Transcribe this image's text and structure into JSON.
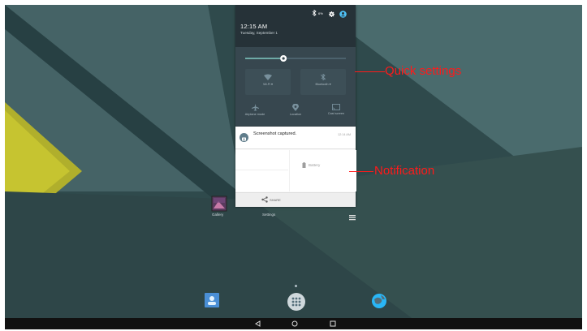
{
  "status_bar": {
    "icons": [
      "bluetooth-icon",
      "battery-icon",
      "gear-icon",
      "account-icon"
    ],
    "battery_percent": "6%"
  },
  "shade": {
    "time": "12:15 AM",
    "date": "Tuesday, September 1"
  },
  "quick_settings": {
    "brightness_level": 0.38,
    "tiles": [
      {
        "label": "Wi-Fi ▾",
        "icon": "wifi-icon"
      },
      {
        "label": "Bluetooth ▾",
        "icon": "bluetooth-icon"
      },
      {
        "label": "Airplane mode",
        "icon": "airplane-icon"
      },
      {
        "label": "Location",
        "icon": "location-icon"
      },
      {
        "label": "Cast screen",
        "icon": "cast-icon"
      }
    ]
  },
  "notification": {
    "title": "Screenshot captured.",
    "time": "12:14 AM",
    "preview_label": "Battery",
    "action_label": "SHARE"
  },
  "home": {
    "apps": [
      {
        "label": "Gallery",
        "icon": "gallery-icon"
      },
      {
        "label": "Settings",
        "icon": "settings-icon"
      }
    ],
    "dock": [
      "contacts-icon",
      "app-drawer-icon",
      "browser-icon"
    ]
  },
  "callouts": {
    "quick_settings": "Quick settings",
    "notification": "Notification"
  },
  "colors": {
    "callout": "#ff1a1a",
    "accent": "#80cbc4",
    "wallpaper_accent": "#c6c430"
  }
}
